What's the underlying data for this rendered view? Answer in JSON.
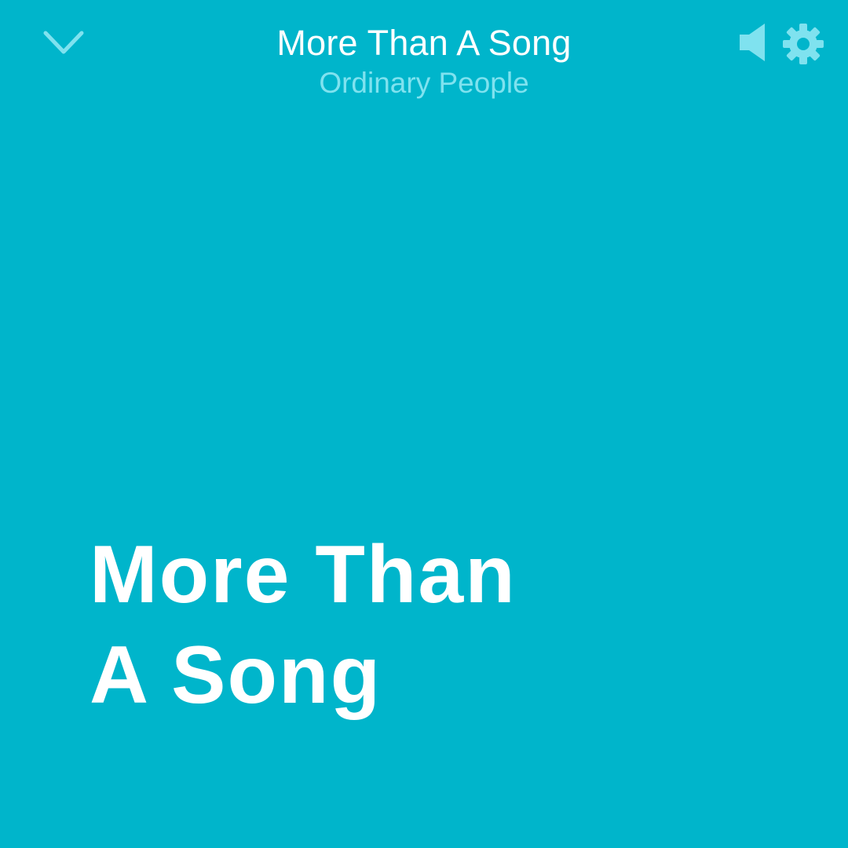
{
  "colors": {
    "background": "#00b5cb",
    "primary_text": "#ffffff",
    "secondary_text": "#7fe2ef"
  },
  "icons": {
    "collapse": "chevron-down-icon",
    "sound": "speaker-icon",
    "settings": "gear-icon"
  },
  "header": {
    "title": "More Than A Song",
    "subtitle": "Ordinary People"
  },
  "lyrics": {
    "lines": [
      "More Than",
      "A Song"
    ]
  }
}
